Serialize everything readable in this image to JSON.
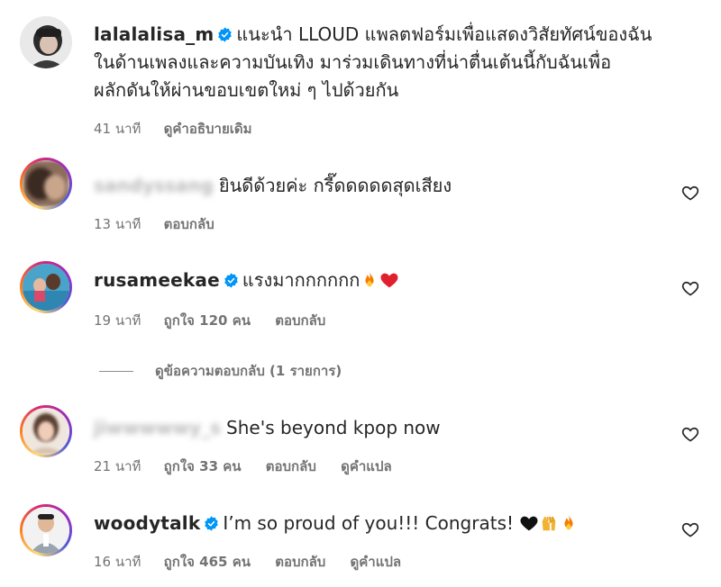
{
  "caption": {
    "username": "lalalalisa_m",
    "verified": true,
    "lines": [
      "แนะนำ LLOUD แพลตฟอร์มเพื่อแสดงวิสัยทัศน์ของฉัน",
      "ในด้านเพลงและความบันเทิง มาร่วมเดินทางที่น่าตื่นเต้นนี้กับฉันเพื่อ",
      "ผลักดันให้ผ่านขอบเขตใหม่ ๆ ไปด้วยกัน"
    ],
    "time": "41 นาที",
    "see_original": "ดูคำอธิบายเดิม"
  },
  "comments": [
    {
      "username": "sandyssang",
      "verified": false,
      "text": "ยินดีด้วยค่ะ กรี๊ดดดดดสุดเสียง",
      "time": "13 นาที",
      "likes": "",
      "reply": "ตอบกลับ",
      "translate": ""
    },
    {
      "username": "rusameekae",
      "verified": true,
      "text": "แรงมากกกกกก",
      "emojis": [
        "fire-emoji",
        "red-heart-emoji"
      ],
      "time": "19 นาที",
      "likes": "ถูกใจ 120 คน",
      "reply": "ตอบกลับ",
      "translate": ""
    },
    {
      "username": "jiwwwwwy_s",
      "verified": false,
      "text": "She's beyond kpop now",
      "time": "21 นาที",
      "likes": "ถูกใจ 33 คน",
      "reply": "ตอบกลับ",
      "translate": "ดูคำแปล"
    },
    {
      "username": "woodytalk",
      "verified": true,
      "text": "I’m so proud of you!!! Congrats!",
      "emojis": [
        "black-heart-emoji",
        "raising-hands-emoji",
        "fire-emoji"
      ],
      "time": "16 นาที",
      "likes": "ถูกใจ 465 คน",
      "reply": "ตอบกลับ",
      "translate": "ดูคำแปล"
    }
  ],
  "view_replies": "ดูข้อความตอบกลับ (1 รายการ)",
  "icons": {
    "verified": "verified-badge-icon",
    "like": "heart-outline-icon"
  },
  "colors": {
    "verified_blue": "#0095f6",
    "meta_gray": "#737373",
    "text": "#262626"
  }
}
